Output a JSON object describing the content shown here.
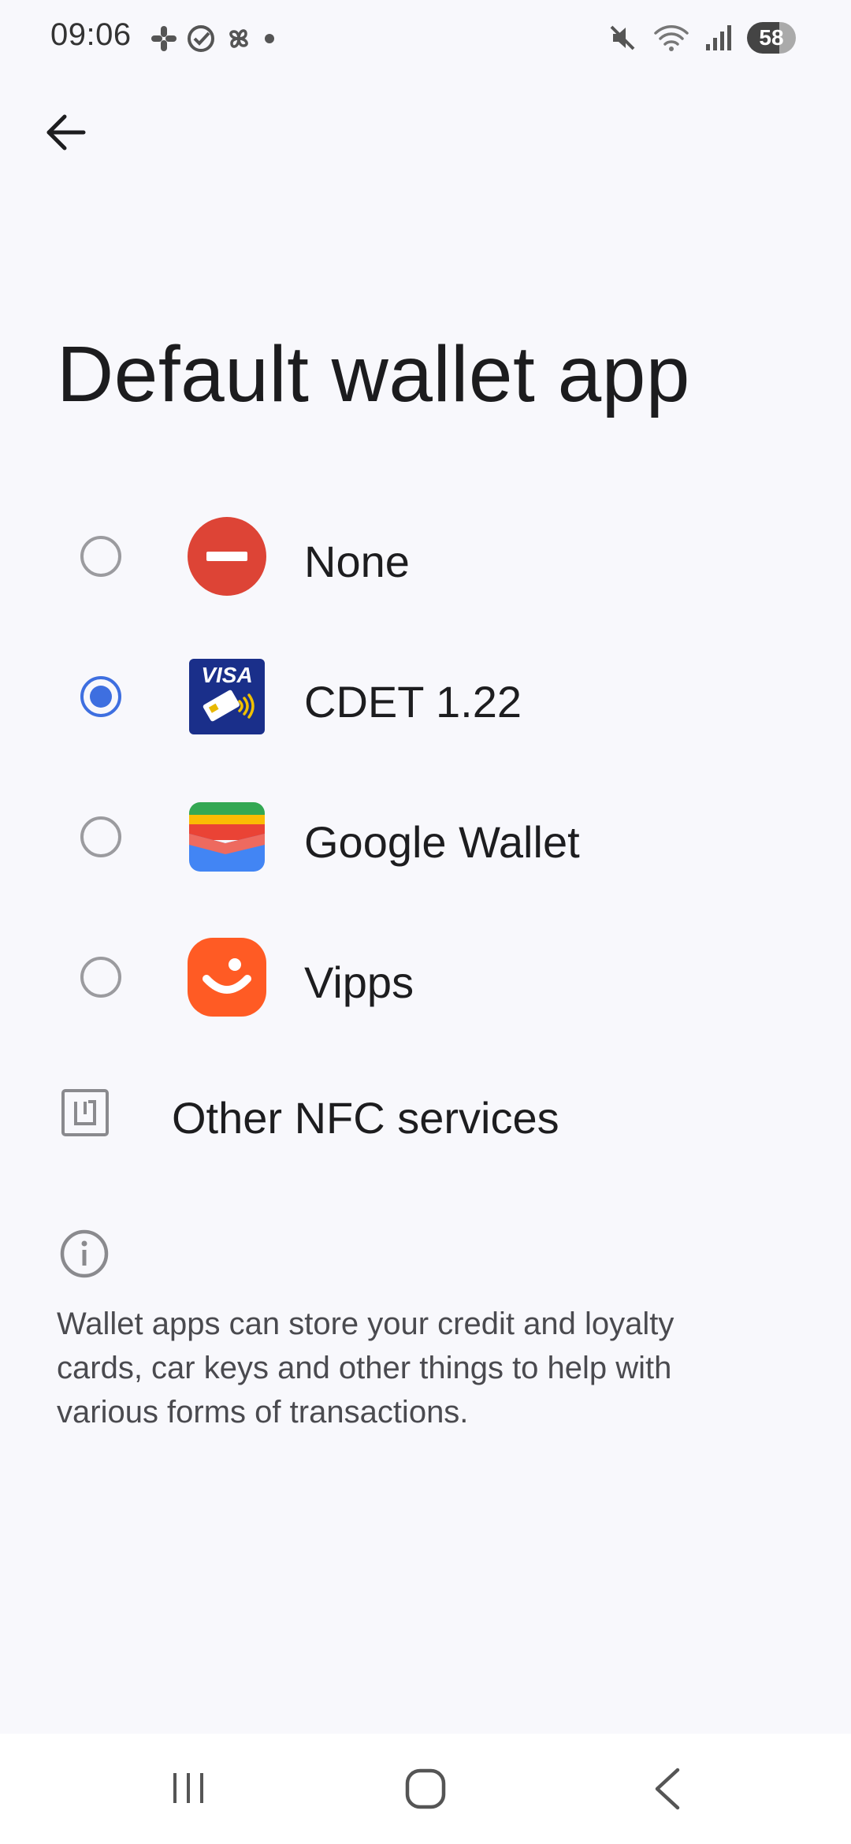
{
  "status_bar": {
    "time": "09:06",
    "battery": "58",
    "left_icons": [
      "slack-icon",
      "check-circle-icon",
      "pinwheel-icon",
      "dot-icon"
    ],
    "right_icons": [
      "mute-icon",
      "wifi-icon",
      "signal-icon",
      "battery-icon"
    ]
  },
  "header": {
    "back_icon": "arrow-back-icon",
    "title": "Default wallet app"
  },
  "options": [
    {
      "label": "None",
      "selected": false,
      "icon": "none-icon",
      "icon_color": "#dd4436"
    },
    {
      "label": "CDET 1.22",
      "selected": true,
      "icon": "visa-cdet-icon",
      "icon_color": "#1a2f8a",
      "icon_text": "VISA"
    },
    {
      "label": "Google Wallet",
      "selected": false,
      "icon": "google-wallet-icon"
    },
    {
      "label": "Vipps",
      "selected": false,
      "icon": "vipps-icon",
      "icon_color": "#ff5b24"
    }
  ],
  "other_nfc": {
    "label": "Other NFC services",
    "icon": "nfc-icon"
  },
  "info": {
    "icon": "info-icon",
    "text": "Wallet apps can store your credit and loyalty cards, car keys and other things to help with various forms of transactions."
  },
  "nav": {
    "recents_icon": "recents-icon",
    "home_icon": "home-icon",
    "back_icon": "nav-back-icon"
  },
  "colors": {
    "accent": "#3e6fe0",
    "background": "#f8f8fc"
  }
}
